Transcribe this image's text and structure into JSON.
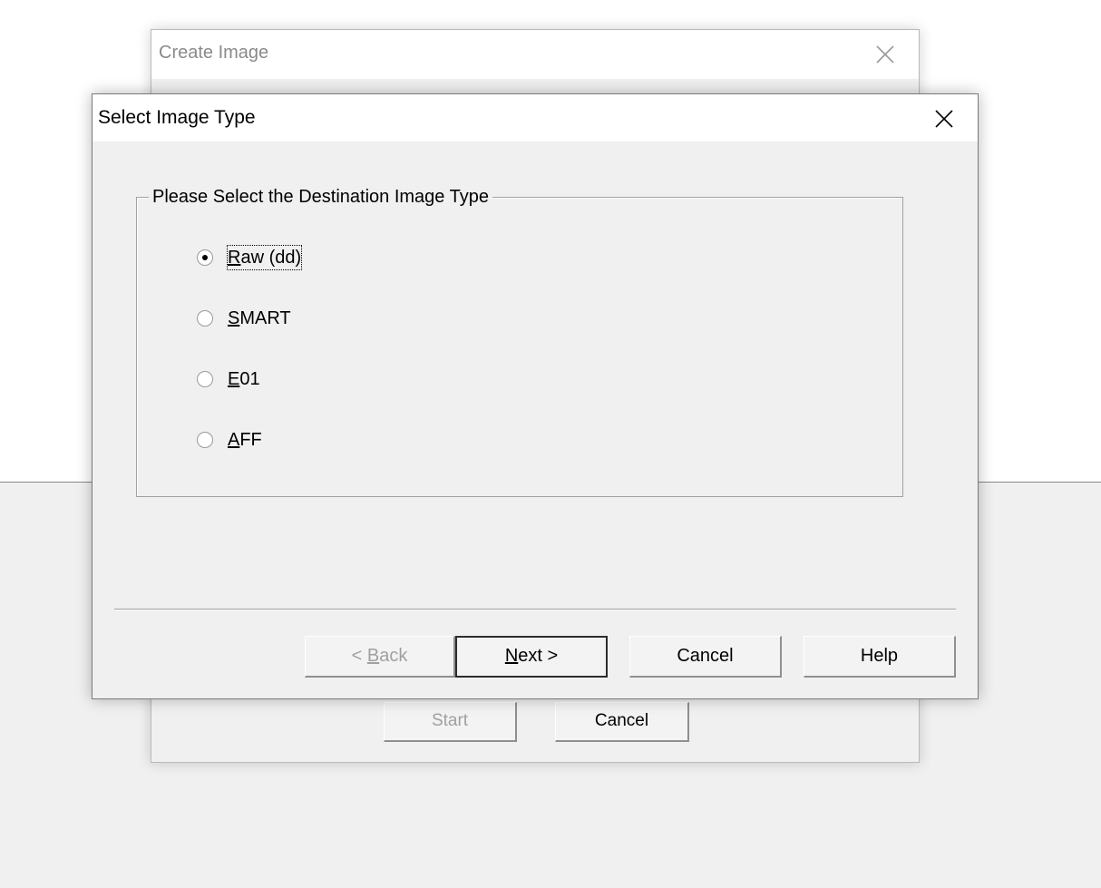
{
  "back_dialog": {
    "title": "Create Image",
    "close_icon": "close-icon",
    "start_label": "Start",
    "cancel_label": "Cancel"
  },
  "dialog": {
    "title": "Select Image Type",
    "close_icon": "close-icon",
    "group_label": "Please Select the Destination Image Type",
    "options": [
      {
        "accel": "R",
        "rest": "aw (dd)",
        "selected": true
      },
      {
        "accel": "S",
        "rest": "MART",
        "selected": false
      },
      {
        "accel": "E",
        "rest": "01",
        "selected": false
      },
      {
        "accel": "A",
        "rest": "FF",
        "selected": false
      }
    ],
    "buttons": {
      "back_prefix": "< ",
      "back_accel": "B",
      "back_rest": "ack",
      "next_accel": "N",
      "next_rest": "ext >",
      "cancel": "Cancel",
      "help": "Help"
    }
  }
}
